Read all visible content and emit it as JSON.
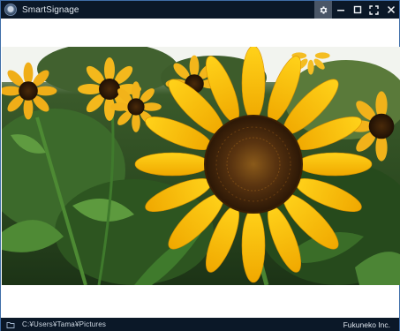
{
  "window": {
    "title": "SmartSignage",
    "controls": [
      "settings-icon",
      "minimize-icon",
      "maximize-icon",
      "fullscreen-icon",
      "close-icon"
    ]
  },
  "image": {
    "subject": "photo"
  },
  "statusbar": {
    "path": "C:¥Users¥Tama¥Pictures",
    "company": "Fukuneko Inc."
  },
  "colors": {
    "titlebar": "#0b1828",
    "settings_button": "#4a5667",
    "window_border": "#3f6ea8"
  }
}
